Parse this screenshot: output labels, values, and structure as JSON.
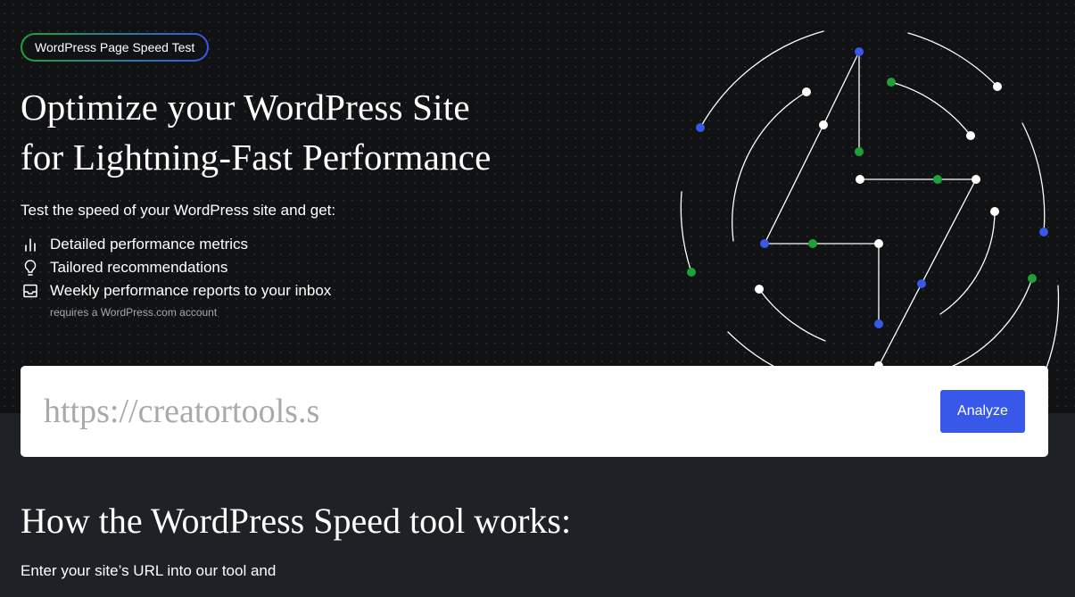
{
  "hero": {
    "badge": "WordPress Page Speed Test",
    "title_line1": "Optimize your WordPress Site",
    "title_line2": "for Lightning-Fast Performance",
    "intro": "Test the speed of your WordPress site and get:",
    "features": [
      {
        "label": "Detailed performance metrics",
        "icon": "bar-chart-icon"
      },
      {
        "label": "Tailored recommendations",
        "icon": "lightbulb-icon"
      },
      {
        "label": "Weekly performance reports to your inbox",
        "icon": "inbox-icon"
      }
    ],
    "note": "requires a WordPress.com account"
  },
  "url_form": {
    "value": "https://creatortools.s",
    "analyze_label": "Analyze"
  },
  "how_it_works": {
    "title": "How the WordPress Speed tool works:",
    "text": "Enter your site’s URL into our tool and"
  },
  "colors": {
    "background": "#1e2125",
    "hero_background": "#101214",
    "accent_blue": "#3858e9",
    "accent_green": "#1fa13a",
    "muted_text": "#a7aaad"
  }
}
